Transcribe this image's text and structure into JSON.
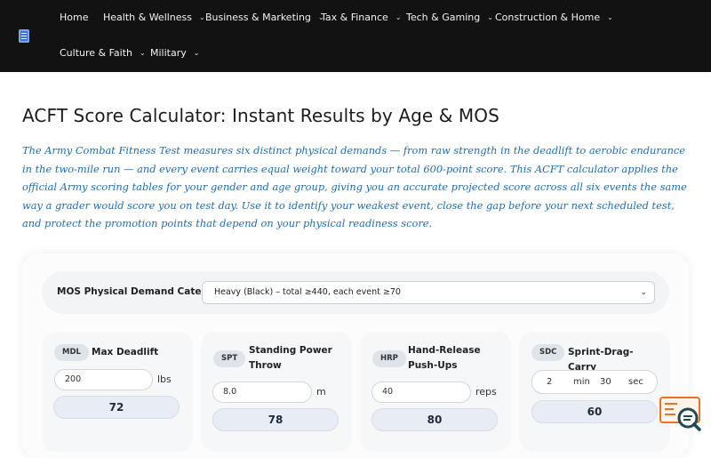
{
  "nav": {
    "items": [
      {
        "label": "Home",
        "has_dropdown": false
      },
      {
        "label": "Health & Wellness",
        "has_dropdown": true
      },
      {
        "label": "Business & Marketing",
        "has_dropdown": true
      },
      {
        "label": "Tax & Finance",
        "has_dropdown": true
      },
      {
        "label": "Tech & Gaming",
        "has_dropdown": true
      },
      {
        "label": "Construction & Home",
        "has_dropdown": true
      },
      {
        "label": "Culture & Faith",
        "has_dropdown": true
      },
      {
        "label": "Military",
        "has_dropdown": true
      }
    ],
    "chevron_glyph": "⌄"
  },
  "page": {
    "title": "ACFT Score Calculator: Instant Results by Age & MOS",
    "intro": "The Army Combat Fitness Test measures six distinct physical demands — from raw strength in the deadlift to aerobic endurance in the two-mile run — and every event carries equal weight toward your total 600-point score. This ACFT calculator applies the official Army scoring tables for your gender and age group, giving you an accurate projected score across all six events the same way a grader would score you on test day. Use it to identify your weakest event, close the gap before your next scheduled test, and protect the promotion points that depend on your physical readiness score."
  },
  "calculator": {
    "mos_label": "MOS Physical Demand Category:",
    "mos_selected": "Heavy (Black) – total ≥440, each event ≥70",
    "events": [
      {
        "code": "MDL",
        "name": "Max Deadlift",
        "value": "200",
        "unit": "lbs",
        "score": "72"
      },
      {
        "code": "SPT",
        "name": "Standing Power Throw",
        "value": "8.0",
        "unit": "m",
        "score": "78"
      },
      {
        "code": "HRP",
        "name": "Hand-Release Push-Ups",
        "value": "40",
        "unit": "reps",
        "score": "80"
      },
      {
        "code": "SDC",
        "name": "Sprint-Drag-Carry",
        "minutes": "2",
        "minutes_unit": "min",
        "seconds": "30",
        "seconds_unit": "sec",
        "score": "60"
      }
    ]
  },
  "colors": {
    "header_bg": "#121212",
    "intro_text": "#1f6db1",
    "accent_orange": "#e8742c",
    "chat_teal": "#1d4a52"
  },
  "icons": {
    "logo": "calculator-logo-icon",
    "chat": "chat-search-icon"
  }
}
